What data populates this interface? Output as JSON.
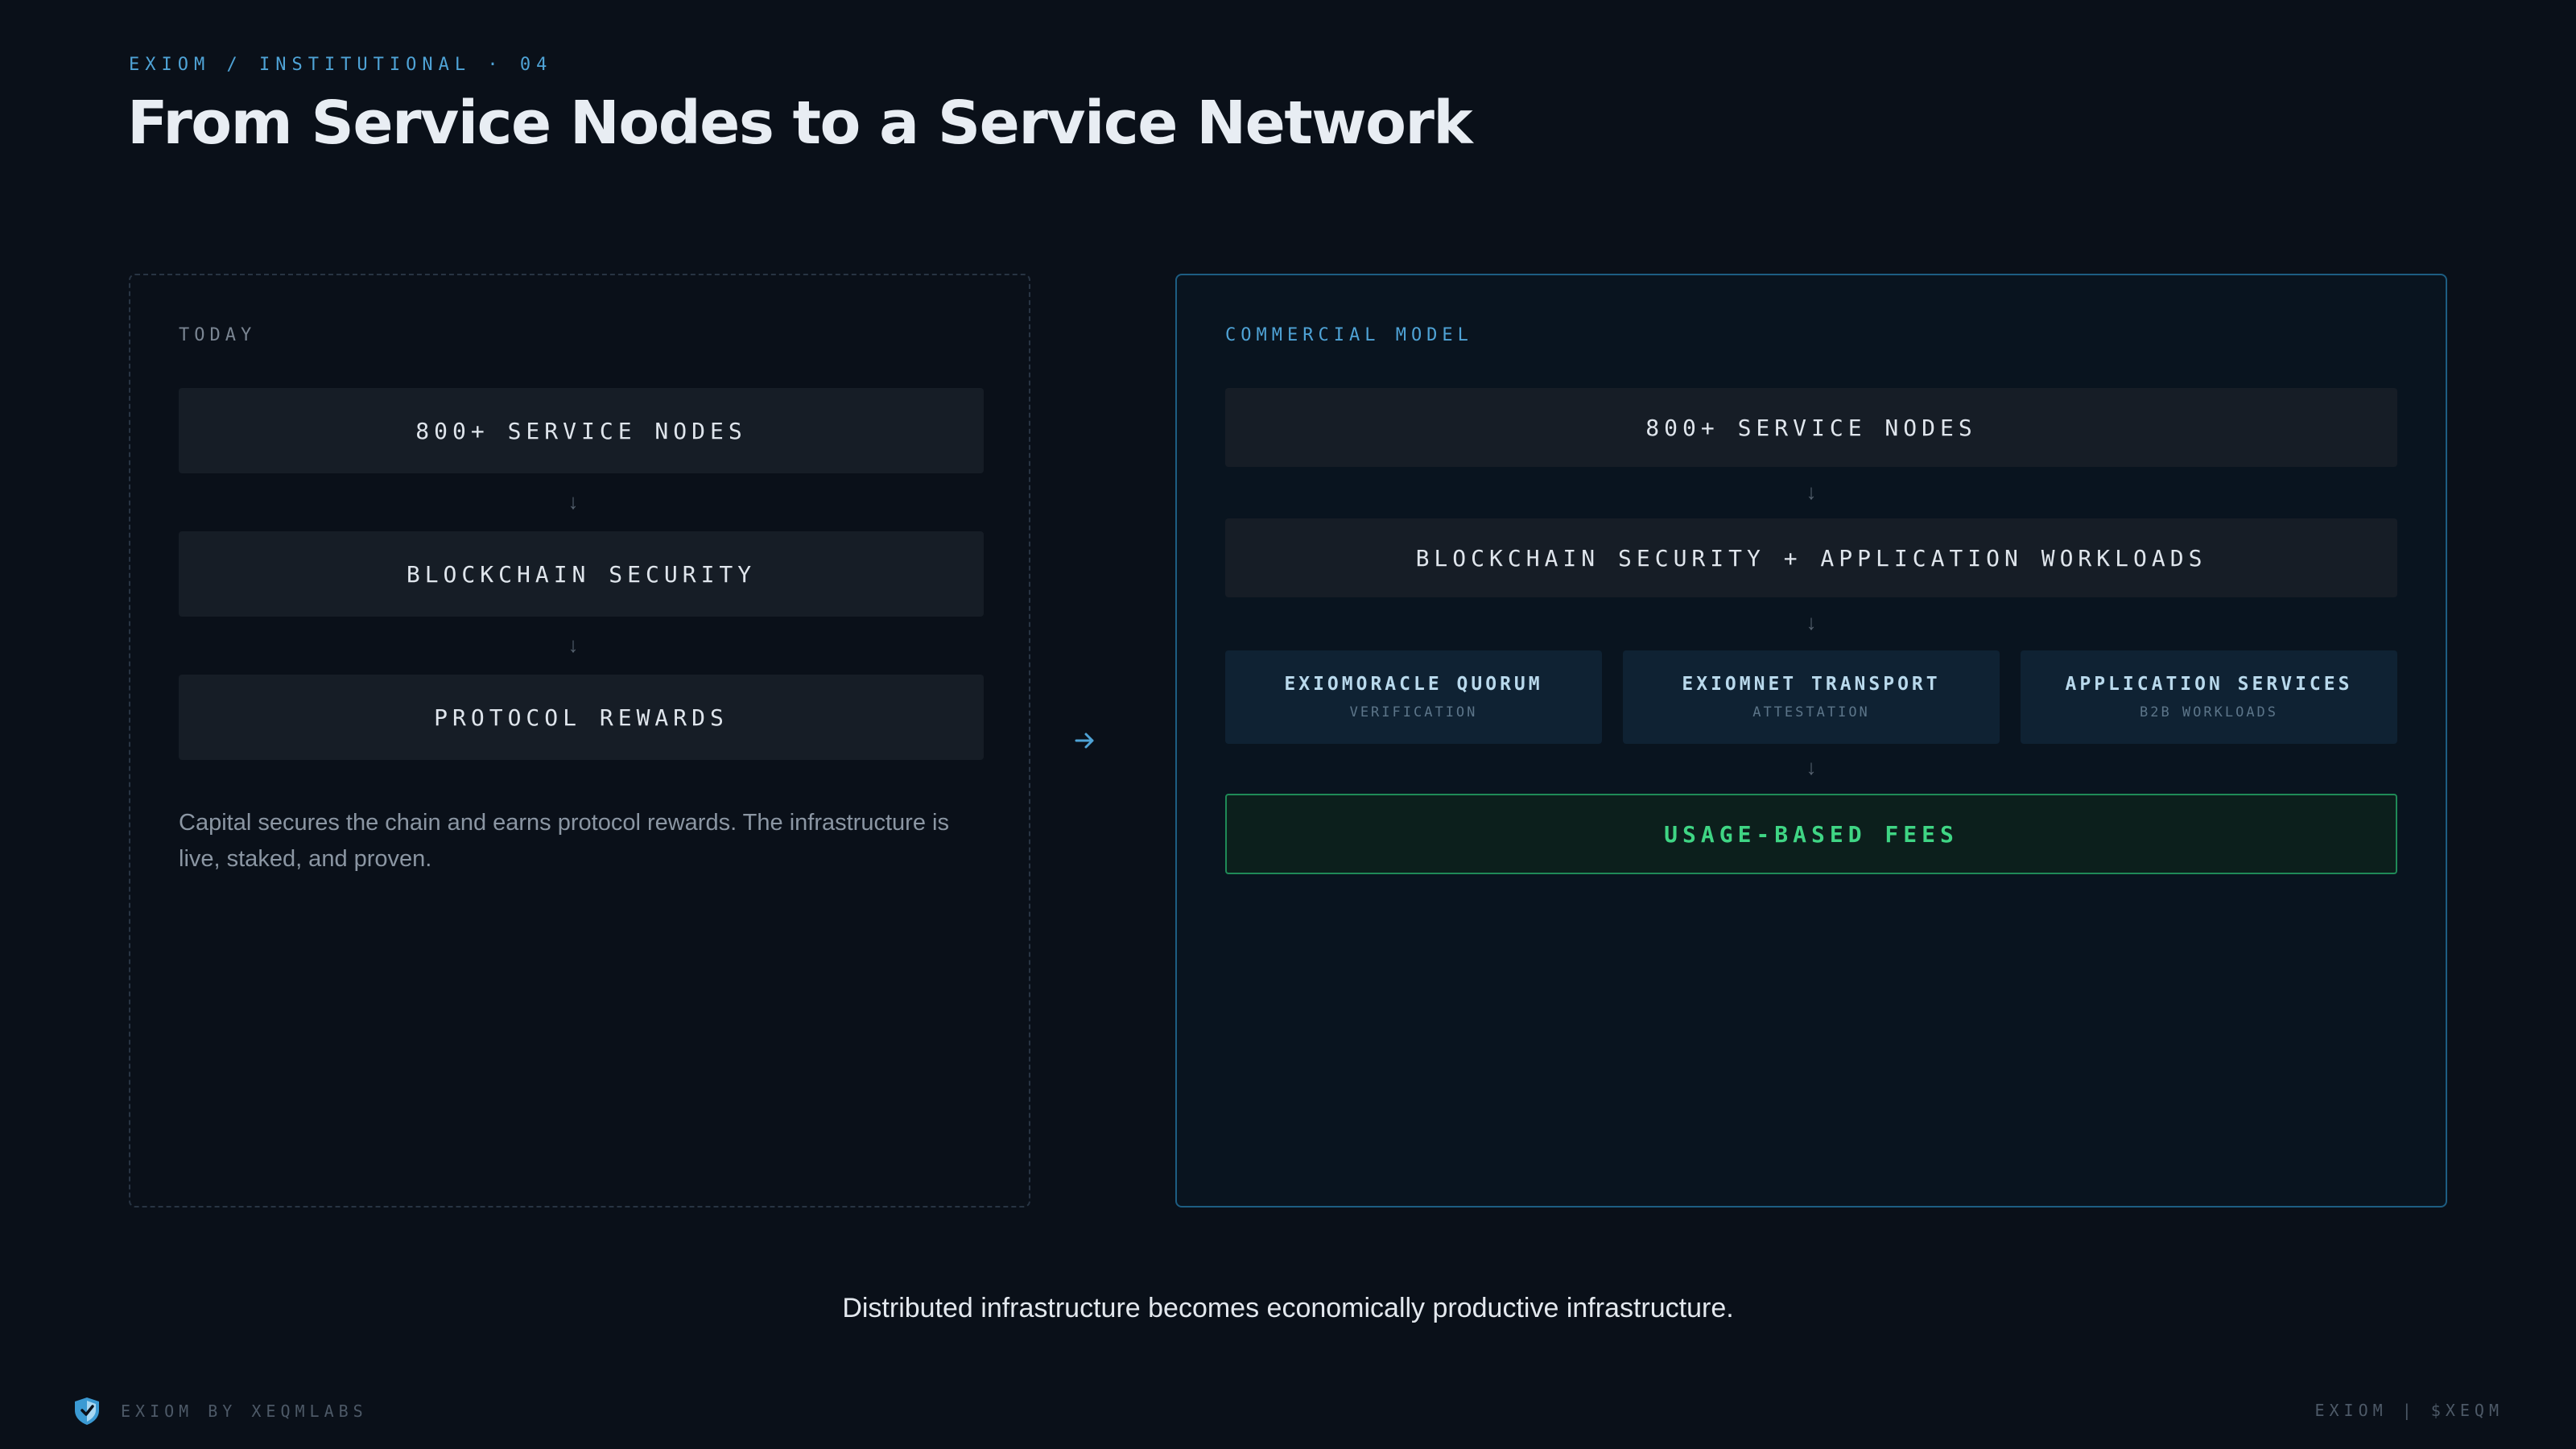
{
  "header": {
    "kicker": "EXIOM / INSTITUTIONAL · 04",
    "title": "From Service Nodes to a Service Network"
  },
  "today": {
    "label": "TODAY",
    "steps": [
      "800+ SERVICE NODES",
      "BLOCKCHAIN SECURITY",
      "PROTOCOL REWARDS"
    ],
    "caption": "Capital secures the chain and earns protocol rewards. The infrastructure is live, staked, and proven."
  },
  "commercial": {
    "label": "COMMERCIAL MODEL",
    "steps": [
      "800+ SERVICE NODES",
      "BLOCKCHAIN SECURITY + APPLICATION WORKLOADS"
    ],
    "services": [
      {
        "title": "EXIOMORACLE QUORUM",
        "caption": "VERIFICATION"
      },
      {
        "title": "EXIOMNET TRANSPORT",
        "caption": "ATTESTATION"
      },
      {
        "title": "APPLICATION SERVICES",
        "caption": "B2B WORKLOADS"
      }
    ],
    "outcome": "USAGE-BASED FEES"
  },
  "tagline": "Distributed infrastructure becomes economically productive infrastructure.",
  "footer": {
    "brand": "EXIOM BY XEQMLABS",
    "right": "EXIOM | $XEQM"
  },
  "colors": {
    "background": "#0a1019",
    "accent_blue": "#4fa3d6",
    "accent_green": "#3fd584"
  },
  "icons": {
    "flow_arrow": "arrow-down-icon",
    "transition": "arrow-right-icon",
    "logo": "shield-logo-icon"
  }
}
